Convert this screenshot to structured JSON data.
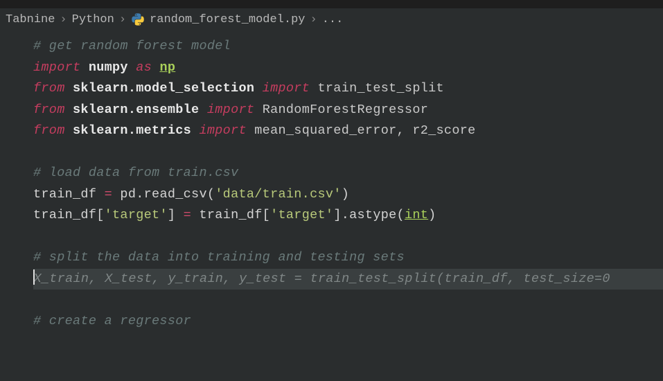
{
  "breadcrumb": {
    "items": [
      "Tabnine",
      "Python",
      "random_forest_model.py",
      "..."
    ],
    "file_icon": "python-icon"
  },
  "code": {
    "l1": "# get random forest model",
    "l2_import": "import",
    "l2_numpy": "numpy",
    "l2_as": "as",
    "l2_np": "np",
    "l3_from": "from",
    "l3_mod": "sklearn.model_selection",
    "l3_import": "import",
    "l3_sym": "train_test_split",
    "l4_from": "from",
    "l4_mod": "sklearn.ensemble",
    "l4_import": "import",
    "l4_sym": "RandomForestRegressor",
    "l5_from": "from",
    "l5_mod": "sklearn.metrics",
    "l5_import": "import",
    "l5_sym": "mean_squared_error, r2_score",
    "l6_blank": "",
    "l7": "# load data from train.csv",
    "l8_a": "train_df ",
    "l8_eq": "=",
    "l8_b": " pd.read_csv(",
    "l8_str": "'data/train.csv'",
    "l8_c": ")",
    "l9_a": "train_df[",
    "l9_str1": "'target'",
    "l9_b": "] ",
    "l9_eq": "=",
    "l9_c": " train_df[",
    "l9_str2": "'target'",
    "l9_d": "].astype(",
    "l9_int": "int",
    "l9_e": ")",
    "l10_blank": "",
    "l11": "# split the data into training and testing sets",
    "l12_suggestion": "X_train, X_test, y_train, y_test = train_test_split(train_df, test_size=0",
    "l13_blank": "",
    "l14": "# create a regressor"
  }
}
